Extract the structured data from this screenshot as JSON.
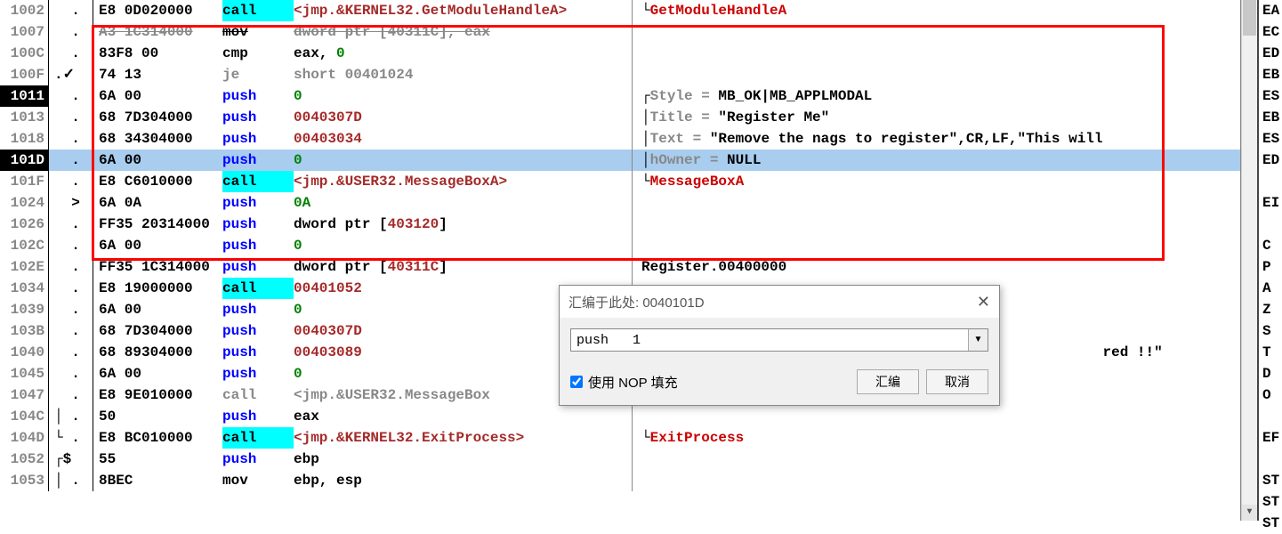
{
  "rows": [
    {
      "addr": "1002",
      "marker": "  .",
      "hex": "E8 0D020000",
      "mnemClass": "call",
      "mnem": "call",
      "ops": [
        {
          "c": "jmp",
          "t": "<jmp.&KERNEL32.GetModuleHandleA>"
        }
      ],
      "comment": [
        {
          "c": "brk",
          "t": "└"
        },
        {
          "c": "api",
          "t": "GetModuleHandleA"
        }
      ]
    },
    {
      "addr": "1007",
      "marker": "  .",
      "strike": true,
      "hex": "A3 1C314000",
      "mnemClass": "mov",
      "mnem": "mov",
      "ops": [
        {
          "c": "gray",
          "t": "dword ptr [40311C], eax"
        }
      ],
      "comment": []
    },
    {
      "addr": "100C",
      "marker": "  .",
      "hex": "83F8 00",
      "mnemClass": "cmp",
      "mnem": "cmp",
      "ops": [
        {
          "c": "reg",
          "t": "eax, "
        },
        {
          "c": "zero",
          "t": "0"
        }
      ],
      "comment": []
    },
    {
      "addr": "100F",
      "marker": ".✓",
      "hex": "74 13",
      "mnemClass": "je",
      "mnem": "je",
      "ops": [
        {
          "c": "gray",
          "t": "short 00401024"
        }
      ],
      "comment": []
    },
    {
      "addr": "1011",
      "addrClass": "curr",
      "marker": "  .",
      "hex": "6A 00",
      "mnemClass": "push",
      "mnem": "push",
      "ops": [
        {
          "c": "zero",
          "t": "0"
        }
      ],
      "comment": [
        {
          "c": "brk",
          "t": "┌"
        },
        {
          "c": "gray",
          "t": "Style = "
        },
        {
          "c": "quote",
          "t": "MB_OK|MB_APPLMODAL"
        }
      ]
    },
    {
      "addr": "1013",
      "marker": "  .",
      "hex": "68 7D304000",
      "mnemClass": "push",
      "mnem": "push",
      "ops": [
        {
          "c": "num",
          "t": "0040307D"
        }
      ],
      "comment": [
        {
          "c": "brk",
          "t": "│"
        },
        {
          "c": "gray",
          "t": "Title = "
        },
        {
          "c": "quote",
          "t": "\"Register Me\""
        }
      ]
    },
    {
      "addr": "1018",
      "marker": "  .",
      "hex": "68 34304000",
      "mnemClass": "push",
      "mnem": "push",
      "ops": [
        {
          "c": "num",
          "t": "00403034"
        }
      ],
      "comment": [
        {
          "c": "brk",
          "t": "│"
        },
        {
          "c": "gray",
          "t": "Text = "
        },
        {
          "c": "quote",
          "t": "\"Remove the nags to register\",CR,LF,\"This will"
        }
      ]
    },
    {
      "addr": "101D",
      "addrClass": "curr",
      "selected": true,
      "marker": "  .",
      "hex": "6A 00",
      "mnemClass": "push",
      "mnem": "push",
      "ops": [
        {
          "c": "zero",
          "t": "0"
        }
      ],
      "comment": [
        {
          "c": "brk",
          "t": "│"
        },
        {
          "c": "gray",
          "t": "hOwner = "
        },
        {
          "c": "quote",
          "t": "NULL"
        }
      ]
    },
    {
      "addr": "101F",
      "marker": "  .",
      "hex": "E8 C6010000",
      "mnemClass": "call",
      "mnem": "call",
      "ops": [
        {
          "c": "jmp",
          "t": "<jmp.&USER32.MessageBoxA>"
        }
      ],
      "comment": [
        {
          "c": "brk",
          "t": "└"
        },
        {
          "c": "api",
          "t": "MessageBoxA"
        }
      ]
    },
    {
      "addr": "1024",
      "marker": "  >",
      "hex": "6A 0A",
      "mnemClass": "push",
      "mnem": "push",
      "ops": [
        {
          "c": "zero",
          "t": "0A"
        }
      ],
      "comment": []
    },
    {
      "addr": "1026",
      "marker": "  .",
      "hex": "FF35 20314000",
      "mnemClass": "push",
      "mnem": "push",
      "ops": [
        {
          "c": "bracket",
          "t": "dword ptr ["
        },
        {
          "c": "num",
          "t": "403120"
        },
        {
          "c": "bracket",
          "t": "]"
        }
      ],
      "comment": []
    },
    {
      "addr": "102C",
      "marker": "  .",
      "hex": "6A 00",
      "mnemClass": "push",
      "mnem": "push",
      "ops": [
        {
          "c": "zero",
          "t": "0"
        }
      ],
      "comment": []
    },
    {
      "addr": "102E",
      "marker": "  .",
      "hex": "FF35 1C314000",
      "mnemClass": "push",
      "mnem": "push",
      "ops": [
        {
          "c": "bracket",
          "t": "dword ptr ["
        },
        {
          "c": "num",
          "t": "40311C"
        },
        {
          "c": "bracket",
          "t": "]"
        }
      ],
      "comment": [
        {
          "c": "quote",
          "t": "Register.00400000"
        }
      ]
    },
    {
      "addr": "1034",
      "marker": "  .",
      "hex": "E8 19000000",
      "mnemClass": "call",
      "mnem": "call",
      "ops": [
        {
          "c": "num",
          "t": "00401052"
        }
      ],
      "comment": []
    },
    {
      "addr": "1039",
      "marker": "  .",
      "hex": "6A 00",
      "mnemClass": "push",
      "mnem": "push",
      "ops": [
        {
          "c": "zero",
          "t": "0"
        }
      ],
      "comment": []
    },
    {
      "addr": "103B",
      "marker": "  .",
      "hex": "68 7D304000",
      "mnemClass": "push",
      "mnem": "push",
      "ops": [
        {
          "c": "num",
          "t": "0040307D"
        }
      ],
      "comment": []
    },
    {
      "addr": "1040",
      "marker": "  .",
      "hex": "68 89304000",
      "mnemClass": "push",
      "mnem": "push",
      "ops": [
        {
          "c": "num",
          "t": "00403089"
        }
      ],
      "comment": [
        {
          "c": "quote",
          "t": "                                                      red !!\""
        }
      ]
    },
    {
      "addr": "1045",
      "marker": "  .",
      "hex": "6A 00",
      "mnemClass": "push",
      "mnem": "push",
      "ops": [
        {
          "c": "zero",
          "t": "0"
        }
      ],
      "comment": []
    },
    {
      "addr": "1047",
      "marker": "  .",
      "hex": "E8 9E010000",
      "mnemClass": "je",
      "mnem": "call",
      "ops": [
        {
          "c": "gray",
          "t": "<jmp.&USER32.MessageBox"
        },
        {
          "c": "gray",
          "t": ""
        }
      ],
      "comment": []
    },
    {
      "addr": "104C",
      "marker": "│ .",
      "hex": "50",
      "mnemClass": "push",
      "mnem": "push",
      "ops": [
        {
          "c": "reg",
          "t": "eax"
        }
      ],
      "comment": []
    },
    {
      "addr": "104D",
      "marker": "└ .",
      "hex": "E8 BC010000",
      "mnemClass": "call",
      "mnem": "call",
      "ops": [
        {
          "c": "jmp",
          "t": "<jmp.&KERNEL32.ExitProcess>"
        }
      ],
      "comment": [
        {
          "c": "brk",
          "t": "└"
        },
        {
          "c": "api",
          "t": "ExitProcess"
        }
      ]
    },
    {
      "addr": "1052",
      "marker": "┌$",
      "hex": "55",
      "mnemClass": "push",
      "mnem": "push",
      "ops": [
        {
          "c": "reg",
          "t": "ebp"
        }
      ],
      "comment": []
    },
    {
      "addr": "1053",
      "marker": "│ .",
      "hex": "8BEC",
      "mnemClass": "mov",
      "mnem": "mov",
      "ops": [
        {
          "c": "reg",
          "t": "ebp, esp"
        }
      ],
      "comment": []
    }
  ],
  "registers": [
    "EA",
    "EC",
    "ED",
    "EB",
    "ES",
    "EB",
    "ES",
    "ED",
    "",
    "EI",
    "",
    "C",
    "P",
    "A",
    "Z",
    "S",
    "T",
    "D",
    "O",
    "",
    "EF",
    "",
    "ST",
    "ST",
    "ST"
  ],
  "dialog": {
    "title": "汇编于此处: 0040101D",
    "input_value": "push   1",
    "checkbox_label": "使用 NOP 填充",
    "assemble_btn": "汇编",
    "cancel_btn": "取消"
  }
}
